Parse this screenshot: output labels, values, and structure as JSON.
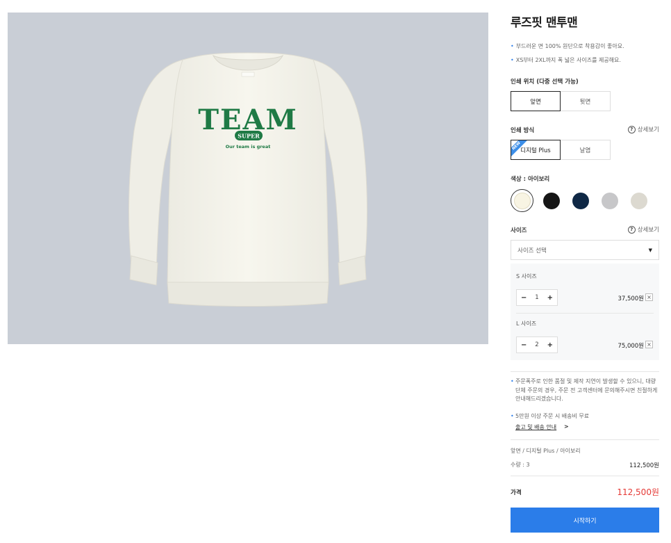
{
  "product": {
    "title": "루즈핏 맨투맨",
    "descriptions": [
      "부드러운 면 100% 원단으로 착용감이 좋아요.",
      "XS부터 2XL까지 폭 넓은 사이즈를 제공해요."
    ],
    "print_graphic": {
      "main_text": "TEAM",
      "badge_text": "SUPER",
      "tagline": "Our team is great"
    }
  },
  "print_position": {
    "label": "인쇄 위치 (다중 선택 가능)",
    "options": [
      "앞면",
      "뒷면"
    ],
    "selected": "앞면"
  },
  "print_method": {
    "label": "인쇄 방식",
    "detail_label": "상세보기",
    "help_icon": "?",
    "options": [
      "디지털 Plus",
      "날염"
    ],
    "selected": "디지털 Plus",
    "new_badge": "NEW"
  },
  "color": {
    "label": "색상 : 아이보리",
    "swatches": [
      {
        "name": "ivory",
        "hex": "#f8f4e3",
        "selected": true
      },
      {
        "name": "black",
        "hex": "#161616",
        "selected": false
      },
      {
        "name": "navy",
        "hex": "#0f2845",
        "selected": false
      },
      {
        "name": "light-gray",
        "hex": "#c7c7c9",
        "selected": false
      },
      {
        "name": "oatmeal",
        "hex": "#dcd9d0",
        "selected": false
      }
    ]
  },
  "size": {
    "label": "사이즈",
    "detail_label": "상세보기",
    "help_icon": "?",
    "select_placeholder": "사이즈 선택",
    "caret": "▼",
    "items": [
      {
        "label": "S 사이즈",
        "qty": "1",
        "price": "37,500원"
      },
      {
        "label": "L 사이즈",
        "qty": "2",
        "price": "75,000원"
      }
    ],
    "minus": "−",
    "plus": "+",
    "remove": "×"
  },
  "notices": [
    "주문폭주로 인한 품절 및 제작 지연이 발생할 수 있으니, 대량 단체 주문의 경우, 주문 전 고객센터에 문의해주시면 친절하게 안내해드리겠습니다.",
    "5만원 이상 주문 시 배송비 무료"
  ],
  "shipping_link": "출고 및 배송 안내",
  "shipping_arrow": ">",
  "summary": {
    "options_text": "앞면 / 디지털 Plus / 아이보리",
    "qty_text": "수량 : 3",
    "total": "112,500원"
  },
  "price": {
    "label": "가격",
    "value": "112,500원"
  },
  "cta_label": "시작하기",
  "colors": {
    "accent": "#2b7de9",
    "price_red": "#e53935",
    "graphic_green": "#1f7a45",
    "image_bg": "#c9ced6"
  }
}
